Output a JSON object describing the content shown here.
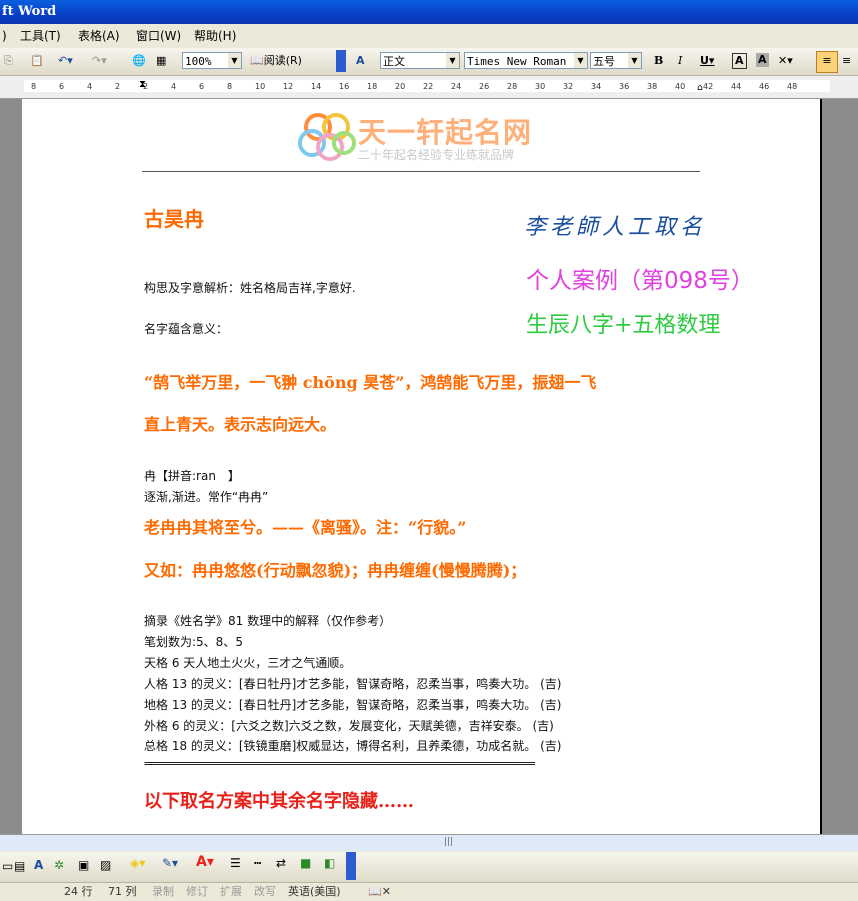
{
  "window": {
    "title": "ft Word"
  },
  "menu": [
    "工具(T)",
    "表格(A)",
    "窗口(W)",
    "帮助(H)"
  ],
  "toolbar": {
    "zoom": "100%",
    "read_label": "阅读(R)",
    "style": "正文",
    "font": "Times New Roman",
    "size": "五号"
  },
  "ruler": {
    "ticks": [
      "8",
      "6",
      "4",
      "2",
      "2",
      "4",
      "6",
      "8",
      "10",
      "12",
      "14",
      "16",
      "18",
      "20",
      "22",
      "24",
      "26",
      "28",
      "30",
      "32",
      "34",
      "36",
      "38",
      "40",
      "42",
      "44",
      "46",
      "48"
    ]
  },
  "doc": {
    "logo_title": "天一轩起名网",
    "logo_subtitle": "二十年起名经验专业练就品牌",
    "name": "古昊冉",
    "stamp1": "李老師人工取名",
    "stamp2": "个人案例（第098号）",
    "stamp3": "生辰八字+五格数理",
    "analysis": "构思及字意解析：姓名格局吉祥,字意好.",
    "meaning_label": "名字蕴含意义：",
    "quote_line1": "“鹄飞举万里，一飞翀 chōng 昊苍”，鸿鹄能飞万里，振翅一飞",
    "quote_line2": "直上青天。表示志向远大。",
    "ran_pinyin": "冉【拼音:ran　】",
    "ran_meaning": "逐渐,渐进。常作“冉冉”",
    "ran_quote1": "老冉冉其将至兮。——《离骚》。注：“行貌。”",
    "ran_quote2": "又如：冉冉悠悠(行动飘忽貌)；冉冉缠缠(慢慢腾腾)；",
    "excerpt": "摘录《姓名学》81 数理中的解释（仅作参考）",
    "strokes": "笔划数为:5、8、5",
    "tian": "天格 6 天人地土火火，三才之气通顺。",
    "ren": "人格 13 的灵义：[春日牡丹]才艺多能，智谋奇略，忍柔当事，鸣奏大功。 (吉)",
    "di": "地格 13 的灵义：[春日牡丹]才艺多能，智谋奇略，忍柔当事，鸣奏大功。 (吉)",
    "wai": "外格 6 的灵义：[六爻之数]六爻之数，发展变化，天赋美德，吉祥安泰。 (吉)",
    "zong": "总格 18 的灵义：[铁镜重磨]权威显达，博得名利，且养柔德，功成名就。 (吉)",
    "separator": "========================================================================",
    "footer": "以下取名方案中其余名字隐藏……"
  },
  "status": {
    "line": "24 行",
    "col": "71 列",
    "rec": "录制",
    "trk": "修订",
    "ext": "扩展",
    "ovr": "改写",
    "lang": "英语(美国)"
  },
  "colors": {
    "orange": "#ff6a00",
    "stamp_blue": "#1a4fa0",
    "stamp_magenta": "#e040e0",
    "stamp_green": "#2ecc40",
    "footer_red": "#e8221a"
  }
}
